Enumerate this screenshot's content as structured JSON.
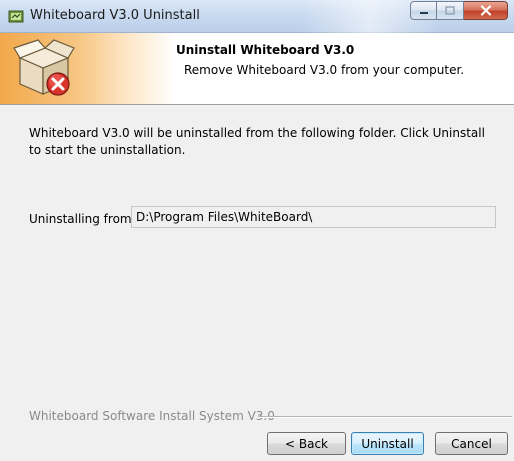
{
  "window": {
    "title": "Whiteboard V3.0 Uninstall",
    "icon": "app-icon",
    "controls": [
      "minimize-icon",
      "maximize-icon",
      "close-icon"
    ]
  },
  "header": {
    "title": "Uninstall Whiteboard V3.0",
    "subtitle": "Remove Whiteboard V3.0 from your computer.",
    "graphic": "uninstall-box-icon"
  },
  "body": {
    "intro": "Whiteboard V3.0 will be uninstalled from the following folder. Click Uninstall to start the uninstallation.",
    "from_label": "Uninstalling from:",
    "from_value": "D:\\Program Files\\WhiteBoard\\"
  },
  "footer": {
    "branding": "Whiteboard Software Install System V3.0",
    "back_label": "< Back",
    "uninstall_label": "Uninstall",
    "cancel_label": "Cancel"
  },
  "colors": {
    "header_gradient_start": "#f2a84a",
    "default_button_border": "#3c7fb1",
    "close_button": "#c0412a"
  }
}
